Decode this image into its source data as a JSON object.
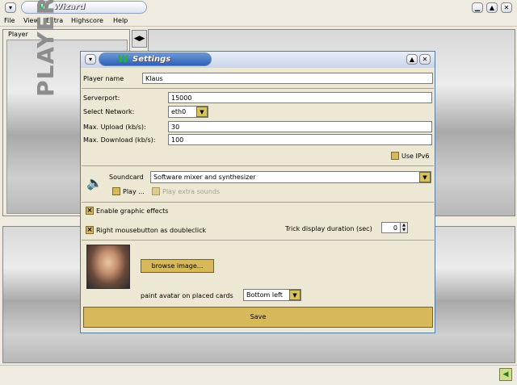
{
  "window": {
    "title": "Wizard",
    "logo": "W"
  },
  "menu": [
    "File",
    "View",
    "Extra",
    "Highscore",
    "Help"
  ],
  "players_panel": {
    "label": "Player",
    "watermark": "PLAYERS"
  },
  "dialog": {
    "title": "Settings",
    "logo": "W",
    "player_name_label": "Player name",
    "player_name_value": "Klaus",
    "serverport_label": "Serverport:",
    "serverport_value": "15000",
    "network_label": "Select Network:",
    "network_value": "eth0",
    "upload_label": "Max. Upload (kb/s):",
    "upload_value": "30",
    "download_label": "Max. Download (kb/s):",
    "download_value": "100",
    "ipv6_label": "Use IPv6",
    "soundcard_label": "Soundcard",
    "soundcard_value": "Software mixer and synthesizer",
    "play_label": "Play ...",
    "play_extra_label": "Play extra sounds",
    "graphic_effects_label": "Enable graphic effects",
    "right_mouse_label": "Right mousebutton as doubleclick",
    "trick_label": "Trick display duration (sec)",
    "trick_value": "0",
    "browse_label": "browse image...",
    "avatar_label": "paint avatar on placed cards",
    "avatar_position": "Bottom left",
    "save_label": "Save"
  },
  "colors": {
    "accent": "#d7b95c",
    "dialog_bg": "#ece8d4",
    "title_blue": "#2f62b5"
  }
}
